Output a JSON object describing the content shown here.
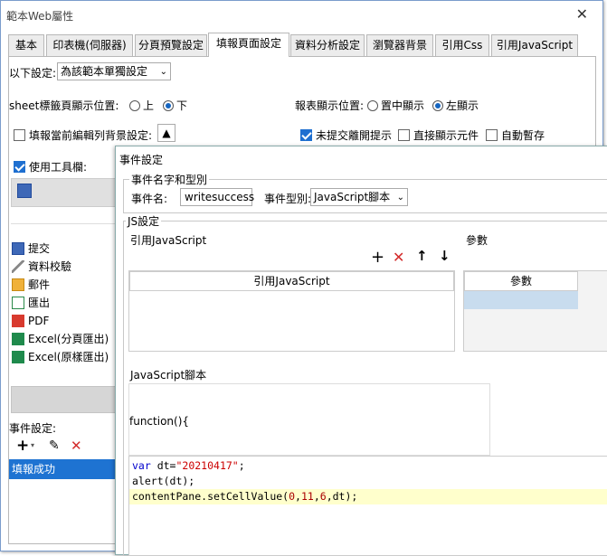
{
  "window": {
    "title": "範本Web屬性",
    "close_glyph": "✕"
  },
  "tabs": [
    {
      "label": "基本"
    },
    {
      "label": "印表機(伺服器)"
    },
    {
      "label": "分頁預覽設定"
    },
    {
      "label": "填報頁面設定"
    },
    {
      "label": "資料分析設定"
    },
    {
      "label": "瀏覽器背景"
    },
    {
      "label": "引用Css"
    },
    {
      "label": "引用JavaScript"
    }
  ],
  "settings": {
    "scope_label": "以下設定:",
    "scope_value": "為該範本單獨設定",
    "sheet_pos_label": "sheet標籤頁顯示位置:",
    "sheet_pos_up": "上",
    "sheet_pos_down": "下",
    "report_pos_label": "報表顯示位置:",
    "report_pos_center": "置中顯示",
    "report_pos_left": "左顯示",
    "fill_row_bg_label": "填報當前編輯列背景設定:",
    "unsubmitted_prompt": "未提交離開提示",
    "show_direct": "直接顯示元件",
    "auto_save": "自動暫存",
    "use_toolbar": "使用工具欄:"
  },
  "toolbar_items": [
    {
      "label": "提交",
      "icon": "save-icon"
    },
    {
      "label": "資料校驗",
      "icon": "verify-icon"
    },
    {
      "label": "郵件",
      "icon": "mail-icon"
    },
    {
      "label": "匯出",
      "icon": "export-icon"
    },
    {
      "label": "PDF",
      "icon": "pdf-icon"
    },
    {
      "label": "Excel(分頁匯出)",
      "icon": "excel-icon"
    },
    {
      "label": "Excel(原樣匯出)",
      "icon": "excel-icon"
    }
  ],
  "events": {
    "label": "事件設定:",
    "items": [
      {
        "label": "填報成功"
      }
    ]
  },
  "dialog": {
    "title": "事件設定",
    "name_type_legend": "事件名字和型別",
    "name_label": "事件名:",
    "name_value": "writesuccess",
    "type_label": "事件型別:",
    "type_value": "JavaScript腳本",
    "js_legend": "JS設定",
    "ref_js_label": "引用JavaScript",
    "params_label": "參數",
    "ref_js_header": "引用JavaScript",
    "params_header": "參數",
    "script_label": "JavaScript腳本",
    "fn_header": "function(){",
    "code": {
      "line1_kw": "var",
      "line1_mid": " dt=",
      "line1_str": "\"20210417\"",
      "line1_end": ";",
      "line2": "alert(dt);",
      "line3_a": "contentPane.setCellValue(",
      "line3_n1": "0",
      "line3_c1": ",",
      "line3_n2": "11",
      "line3_c2": ",",
      "line3_n3": "6",
      "line3_c3": ",dt)",
      "line3_end": ";"
    }
  },
  "colors": {
    "accent": "#1e6fd0",
    "selection": "#1e73d2",
    "highlight_line": "#ffffcc",
    "table_selection": "#c8dcee"
  }
}
